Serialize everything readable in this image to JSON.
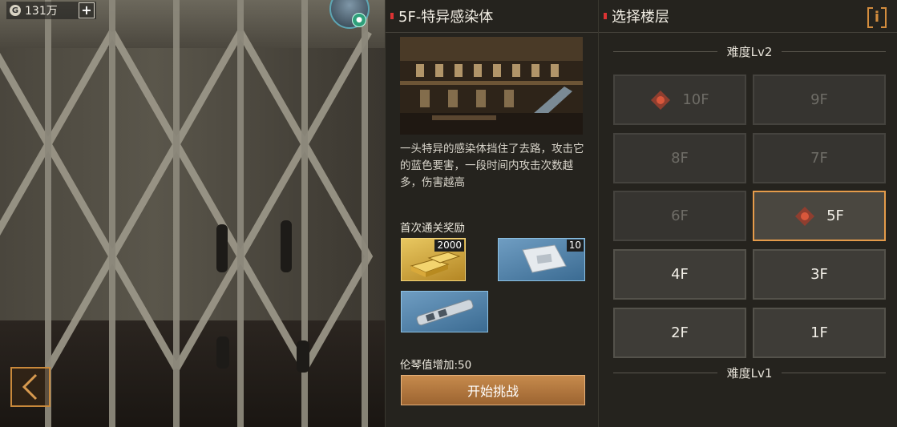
{
  "currency": {
    "amount": "131万",
    "add_label": "+"
  },
  "stage": {
    "title": "5F-特异感染体",
    "description": "一头特异的感染体挡住了去路，攻击它的蓝色要害，一段时间内攻击次数越多，伤害越高",
    "reward_label": "首次通关奖励",
    "rewards": [
      {
        "icon": "gold-bars-icon",
        "count": "2000"
      },
      {
        "icon": "supply-pack-icon",
        "count": "10"
      },
      {
        "icon": "weapon-part-icon",
        "count": ""
      }
    ],
    "bonus": "伦琴值增加:50",
    "start_label": "开始挑战"
  },
  "floor_select": {
    "title": "选择楼层",
    "info_label": "i",
    "difficulty_upper": "难度Lv2",
    "difficulty_lower": "难度Lv1",
    "floors": [
      {
        "label": "10F",
        "state": "locked",
        "boss": true
      },
      {
        "label": "9F",
        "state": "locked",
        "boss": false
      },
      {
        "label": "8F",
        "state": "locked",
        "boss": false
      },
      {
        "label": "7F",
        "state": "locked",
        "boss": false
      },
      {
        "label": "6F",
        "state": "locked",
        "boss": false
      },
      {
        "label": "5F",
        "state": "selected",
        "boss": true
      },
      {
        "label": "4F",
        "state": "available",
        "boss": false
      },
      {
        "label": "3F",
        "state": "available",
        "boss": false
      },
      {
        "label": "2F",
        "state": "available",
        "boss": false
      },
      {
        "label": "1F",
        "state": "available",
        "boss": false
      }
    ]
  },
  "colors": {
    "accent": "#e59b4a",
    "marker": "#d9573b",
    "panel": "#25231e"
  }
}
